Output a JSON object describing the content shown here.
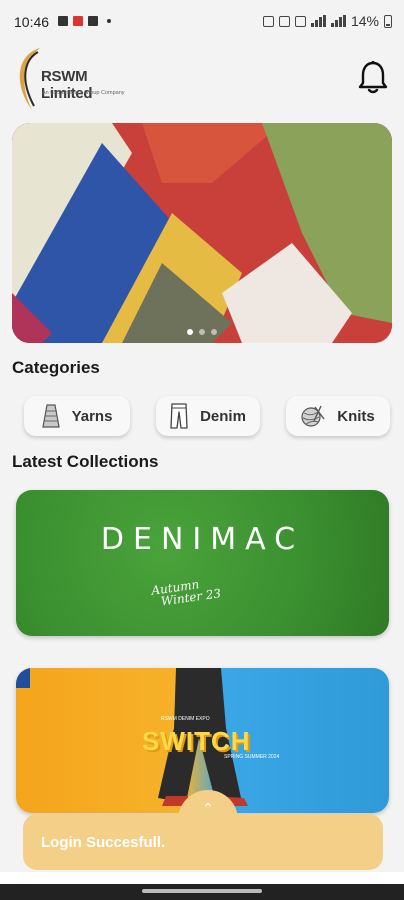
{
  "status_bar": {
    "time": "10:46",
    "battery": "14%"
  },
  "header": {
    "logo_title": "RSWM Limited",
    "logo_subtitle": "An LNJ Bhilwara Group Company",
    "notification_icon": "bell-icon"
  },
  "hero": {
    "slides_count": 3,
    "active_slide": 1
  },
  "categories": {
    "title": "Categories",
    "items": [
      {
        "label": "Yarns",
        "icon": "yarn-cone-icon"
      },
      {
        "label": "Denim",
        "icon": "jeans-icon"
      },
      {
        "label": "Knits",
        "icon": "yarn-ball-icon"
      }
    ]
  },
  "collections": {
    "title": "Latest Collections",
    "items": [
      {
        "headline": "DENIMAC",
        "season_line1": "Autumn",
        "season_line2": "Winter 23"
      },
      {
        "headline": "SWITCH",
        "tag": "RSWM DENIM EXPO",
        "season": "SPRING SUMMER 2024"
      }
    ]
  },
  "toast": {
    "message": "Login Succesfull."
  },
  "colors": {
    "accent": "#f4cf88",
    "background": "#f3f3f3",
    "logo_gold": "#d9a441"
  }
}
